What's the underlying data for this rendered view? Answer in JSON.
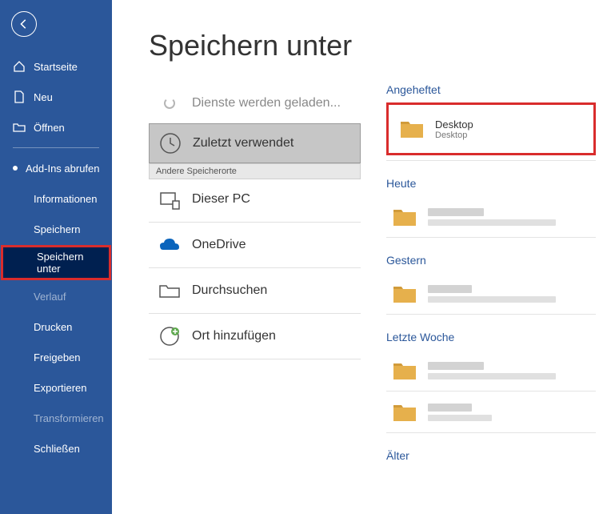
{
  "sidebar": {
    "home": "Startseite",
    "new": "Neu",
    "open": "Öffnen",
    "addins": "Add-Ins abrufen",
    "info": "Informationen",
    "save": "Speichern",
    "saveas": "Speichern unter",
    "history": "Verlauf",
    "print": "Drucken",
    "share": "Freigeben",
    "export": "Exportieren",
    "transform": "Transformieren",
    "close": "Schließen"
  },
  "page": {
    "title": "Speichern unter"
  },
  "locations": {
    "loading": "Dienste werden geladen...",
    "recent": "Zuletzt verwendet",
    "other_label": "Andere Speicherorte",
    "thispc": "Dieser PC",
    "onedrive": "OneDrive",
    "browse": "Durchsuchen",
    "addplace": "Ort hinzufügen"
  },
  "recent": {
    "pinned_heading": "Angeheftet",
    "pinned": {
      "title": "Desktop",
      "subtitle": "Desktop"
    },
    "today_heading": "Heute",
    "yesterday_heading": "Gestern",
    "lastweek_heading": "Letzte Woche",
    "older_heading": "Älter"
  }
}
